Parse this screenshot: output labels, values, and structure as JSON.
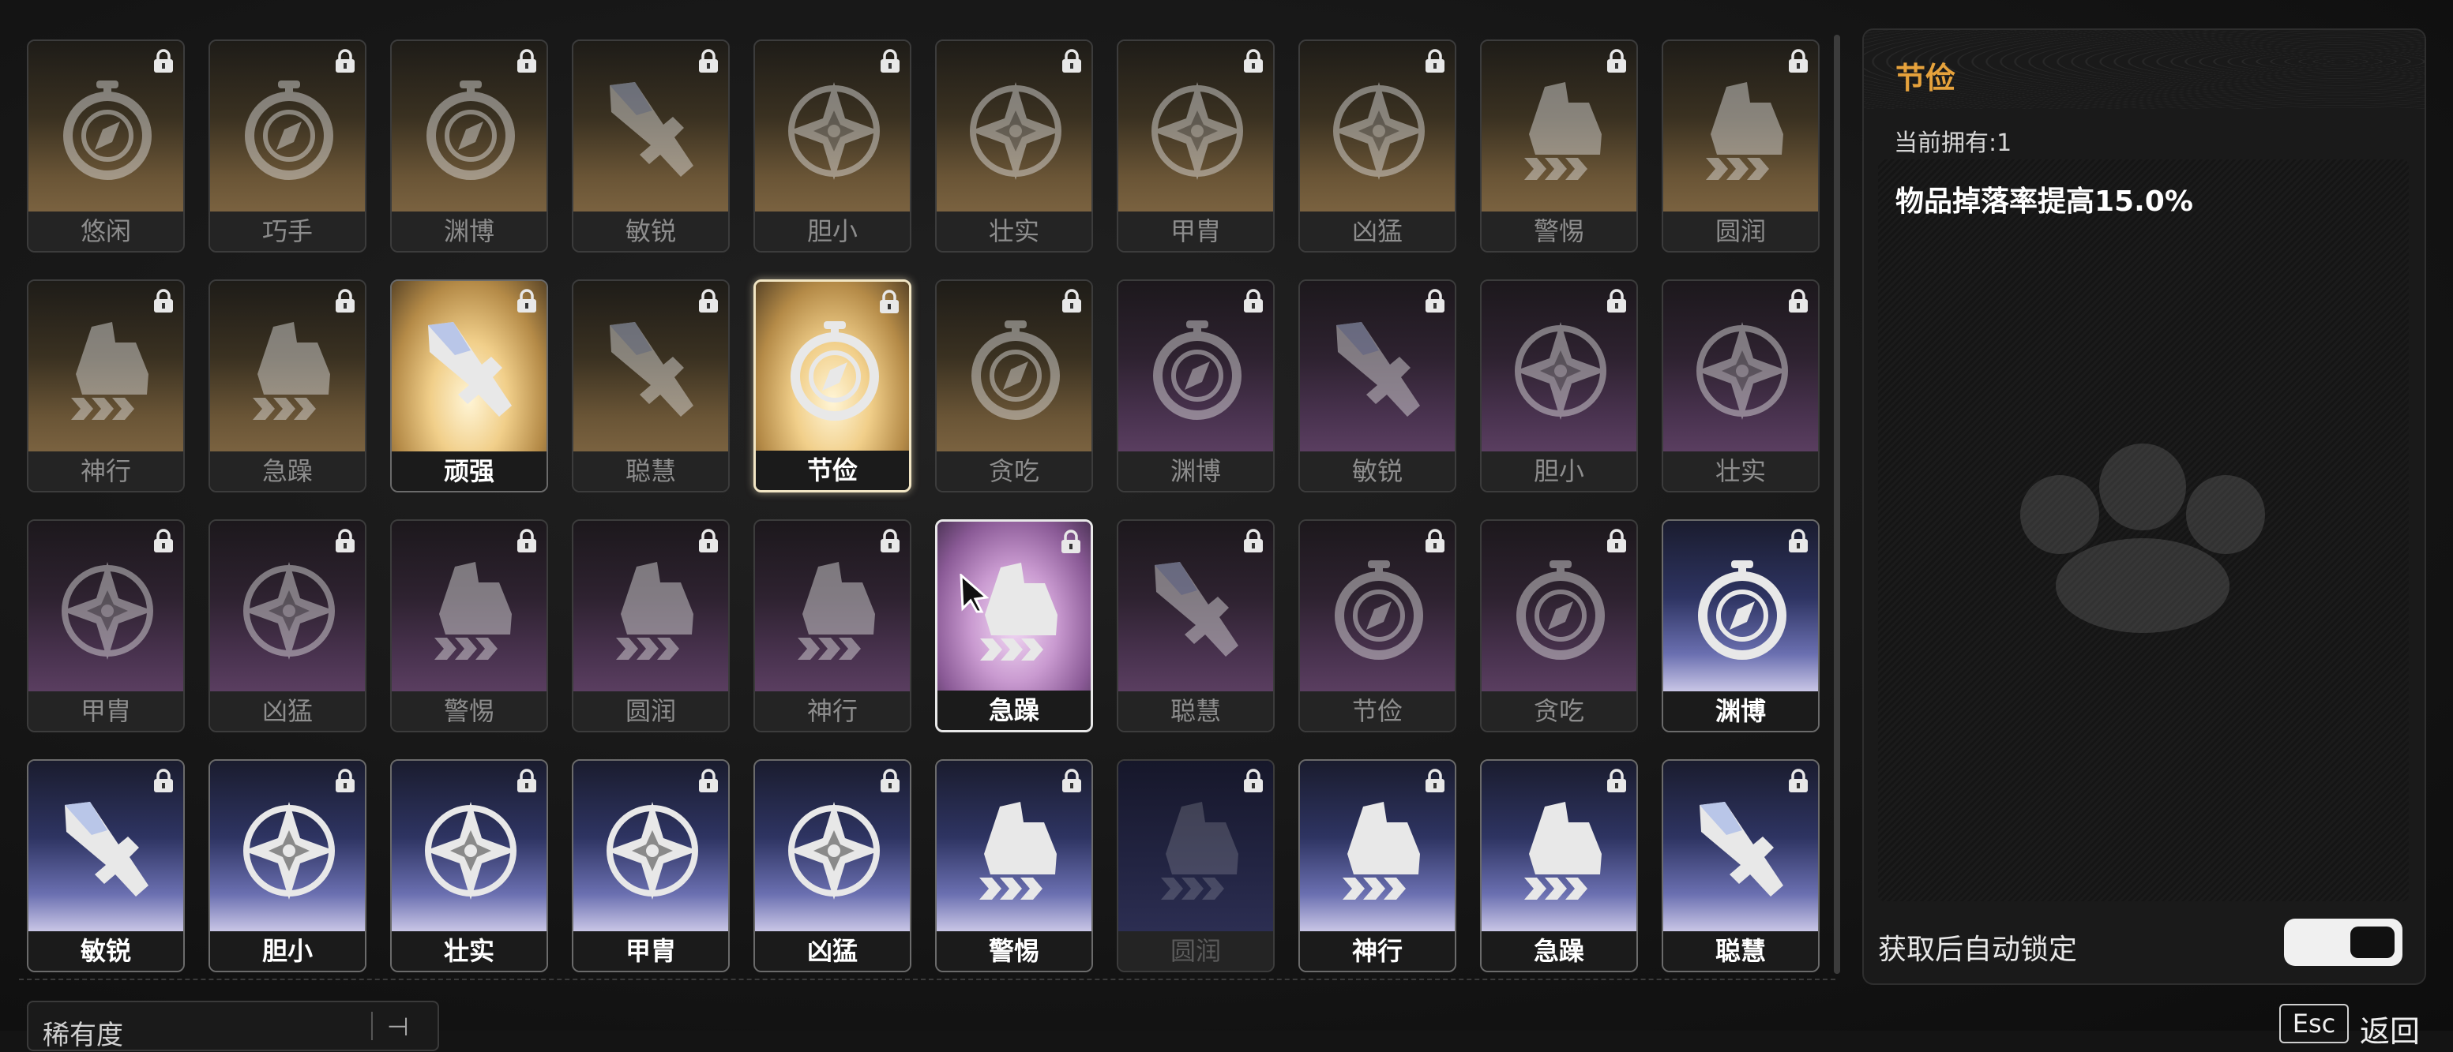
{
  "grid": {
    "cards": [
      {
        "label": "悠闲",
        "icon": "compass",
        "theme": "gold",
        "state": "dim"
      },
      {
        "label": "巧手",
        "icon": "compass",
        "theme": "gold",
        "state": "dim"
      },
      {
        "label": "渊博",
        "icon": "compass",
        "theme": "gold",
        "state": "dim"
      },
      {
        "label": "敏锐",
        "icon": "sword",
        "theme": "gold",
        "state": "dim"
      },
      {
        "label": "胆小",
        "icon": "star",
        "theme": "gold",
        "state": "dim"
      },
      {
        "label": "壮实",
        "icon": "star",
        "theme": "gold",
        "state": "dim"
      },
      {
        "label": "甲胄",
        "icon": "star",
        "theme": "gold",
        "state": "dim"
      },
      {
        "label": "凶猛",
        "icon": "star",
        "theme": "gold",
        "state": "dim"
      },
      {
        "label": "警惕",
        "icon": "boot",
        "theme": "gold",
        "state": "dim"
      },
      {
        "label": "圆润",
        "icon": "boot",
        "theme": "gold",
        "state": "dim"
      },
      {
        "label": "神行",
        "icon": "boot",
        "theme": "gold",
        "state": "dim"
      },
      {
        "label": "急躁",
        "icon": "boot",
        "theme": "gold",
        "state": "dim"
      },
      {
        "label": "顽强",
        "icon": "sword",
        "theme": "gold",
        "state": "bright"
      },
      {
        "label": "聪慧",
        "icon": "sword",
        "theme": "gold",
        "state": "dim"
      },
      {
        "label": "节俭",
        "icon": "compass",
        "theme": "gold",
        "state": "selected"
      },
      {
        "label": "贪吃",
        "icon": "compass",
        "theme": "gold",
        "state": "dim"
      },
      {
        "label": "渊博",
        "icon": "compass",
        "theme": "purple",
        "state": "dim"
      },
      {
        "label": "敏锐",
        "icon": "sword",
        "theme": "purple",
        "state": "dim"
      },
      {
        "label": "胆小",
        "icon": "star",
        "theme": "purple",
        "state": "dim"
      },
      {
        "label": "壮实",
        "icon": "star",
        "theme": "purple",
        "state": "dim"
      },
      {
        "label": "甲胄",
        "icon": "star",
        "theme": "purple",
        "state": "dim"
      },
      {
        "label": "凶猛",
        "icon": "star",
        "theme": "purple",
        "state": "dim"
      },
      {
        "label": "警惕",
        "icon": "boot",
        "theme": "purple",
        "state": "dim"
      },
      {
        "label": "圆润",
        "icon": "boot",
        "theme": "purple",
        "state": "dim"
      },
      {
        "label": "神行",
        "icon": "boot",
        "theme": "purple",
        "state": "dim"
      },
      {
        "label": "急躁",
        "icon": "boot",
        "theme": "purple",
        "state": "hover"
      },
      {
        "label": "聪慧",
        "icon": "sword",
        "theme": "purple",
        "state": "dim"
      },
      {
        "label": "节俭",
        "icon": "compass",
        "theme": "purple",
        "state": "dim"
      },
      {
        "label": "贪吃",
        "icon": "compass",
        "theme": "purple",
        "state": "dim"
      },
      {
        "label": "渊博",
        "icon": "compass",
        "theme": "blue",
        "state": "bright"
      },
      {
        "label": "敏锐",
        "icon": "sword",
        "theme": "blue",
        "state": "bright"
      },
      {
        "label": "胆小",
        "icon": "star",
        "theme": "blue",
        "state": "bright"
      },
      {
        "label": "壮实",
        "icon": "star",
        "theme": "blue",
        "state": "bright"
      },
      {
        "label": "甲胄",
        "icon": "star",
        "theme": "blue",
        "state": "bright"
      },
      {
        "label": "凶猛",
        "icon": "star",
        "theme": "blue",
        "state": "bright"
      },
      {
        "label": "警惕",
        "icon": "boot",
        "theme": "blue",
        "state": "bright"
      },
      {
        "label": "圆润",
        "icon": "boot",
        "theme": "blue",
        "state": "faint"
      },
      {
        "label": "神行",
        "icon": "boot",
        "theme": "blue",
        "state": "bright"
      },
      {
        "label": "急躁",
        "icon": "boot",
        "theme": "blue",
        "state": "bright"
      },
      {
        "label": "聪慧",
        "icon": "sword",
        "theme": "blue",
        "state": "bright"
      }
    ]
  },
  "detail": {
    "title": "节俭",
    "owned": "当前拥有:1",
    "description": "物品掉落率提高15.0%",
    "auto_lock_label": "获取后自动锁定",
    "title_color": "#e6a23c"
  },
  "bottom": {
    "rarity_label": "稀有度",
    "esc_key": "Esc",
    "back_label": "返回"
  }
}
